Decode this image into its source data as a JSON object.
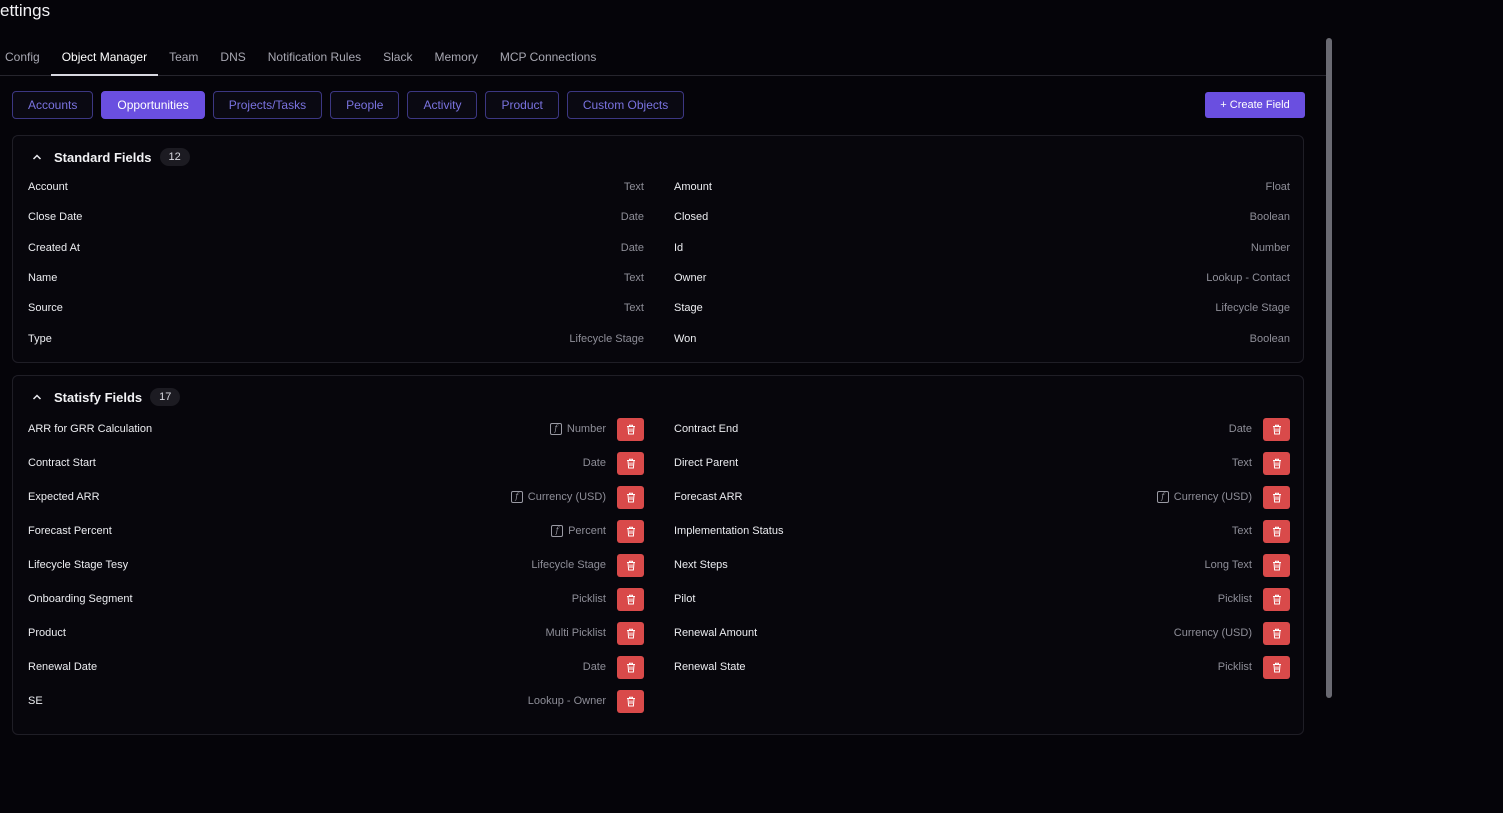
{
  "page": {
    "title": "ettings"
  },
  "tabs": [
    "Config",
    "Object Manager",
    "Team",
    "DNS",
    "Notification Rules",
    "Slack",
    "Memory",
    "MCP Connections"
  ],
  "active_tab": "Object Manager",
  "objects": [
    "Accounts",
    "Opportunities",
    "Projects/Tasks",
    "People",
    "Activity",
    "Product",
    "Custom Objects"
  ],
  "active_object": "Opportunities",
  "create_field_label": "+ Create Field",
  "standard": {
    "title": "Standard Fields",
    "count": "12",
    "left": [
      {
        "name": "Account",
        "type": "Text"
      },
      {
        "name": "Close Date",
        "type": "Date"
      },
      {
        "name": "Created At",
        "type": "Date"
      },
      {
        "name": "Name",
        "type": "Text"
      },
      {
        "name": "Source",
        "type": "Text"
      },
      {
        "name": "Type",
        "type": "Lifecycle Stage"
      }
    ],
    "right": [
      {
        "name": "Amount",
        "type": "Float"
      },
      {
        "name": "Closed",
        "type": "Boolean"
      },
      {
        "name": "Id",
        "type": "Number"
      },
      {
        "name": "Owner",
        "type": "Lookup - Contact"
      },
      {
        "name": "Stage",
        "type": "Lifecycle Stage"
      },
      {
        "name": "Won",
        "type": "Boolean"
      }
    ]
  },
  "statisfy": {
    "title": "Statisfy Fields",
    "count": "17",
    "left": [
      {
        "name": "ARR for GRR Calculation",
        "type": "Number",
        "formula": true
      },
      {
        "name": "Contract Start",
        "type": "Date",
        "formula": false
      },
      {
        "name": "Expected ARR",
        "type": "Currency (USD)",
        "formula": true
      },
      {
        "name": "Forecast Percent",
        "type": "Percent",
        "formula": true
      },
      {
        "name": "Lifecycle Stage Tesy",
        "type": "Lifecycle Stage",
        "formula": false
      },
      {
        "name": "Onboarding Segment",
        "type": "Picklist",
        "formula": false
      },
      {
        "name": "Product",
        "type": "Multi Picklist",
        "formula": false
      },
      {
        "name": "Renewal Date",
        "type": "Date",
        "formula": false
      },
      {
        "name": "SE",
        "type": "Lookup - Owner",
        "formula": false
      }
    ],
    "right": [
      {
        "name": "Contract End",
        "type": "Date",
        "formula": false
      },
      {
        "name": "Direct Parent",
        "type": "Text",
        "formula": false
      },
      {
        "name": "Forecast ARR",
        "type": "Currency (USD)",
        "formula": true
      },
      {
        "name": "Implementation Status",
        "type": "Text",
        "formula": false
      },
      {
        "name": "Next Steps",
        "type": "Long Text",
        "formula": false
      },
      {
        "name": "Pilot",
        "type": "Picklist",
        "formula": false
      },
      {
        "name": "Renewal Amount",
        "type": "Currency (USD)",
        "formula": false
      },
      {
        "name": "Renewal State",
        "type": "Picklist",
        "formula": false
      }
    ]
  },
  "icons": {
    "collapse": "chevron-up-icon",
    "delete": "trash-icon",
    "formula": "formula-icon"
  },
  "colors": {
    "accent": "#6a4fe0",
    "delete": "#d94a4a",
    "background": "#050409"
  }
}
